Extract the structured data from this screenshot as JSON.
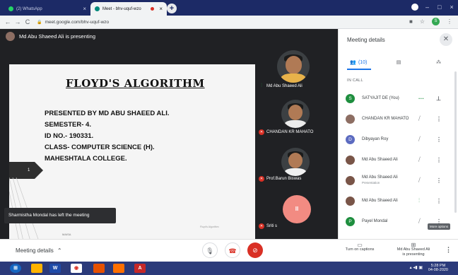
{
  "browser": {
    "tabs": [
      {
        "label": "(2) WhatsApp",
        "close": "×"
      },
      {
        "label": "Meet - bhv-uquf-wzo",
        "close": "×"
      }
    ],
    "new_tab": "+",
    "url": "meet.google.com/bhv-uquf-wzo"
  },
  "stage": {
    "presenting_text": "Md Abu Shaeed Ali is presenting"
  },
  "slide": {
    "title": "FLOYD'S ALGORITHM",
    "lines": [
      "PRESENTED BY MD ABU SHAEED ALI.",
      "SEMESTER- 4.",
      "ID NO.- 190331.",
      "CLASS- COMPUTER SCIENCE (H).",
      "MAHESHTALA COLLEGE."
    ],
    "page_number": "1",
    "footer_left": "MAISA",
    "footer_right": "Floyd's Algorithm"
  },
  "toast": "Sharmistha Mondal has left the meeting",
  "tiles": [
    {
      "name": "Md Abu Shaeed Ali"
    },
    {
      "name": "CHANDAN KR MAHATO"
    },
    {
      "name": "Prof.Barun Biswas"
    },
    {
      "name": "Sriti s",
      "initial": "II"
    }
  ],
  "panel": {
    "title": "Meeting details",
    "people_count": "(10)",
    "in_call_label": "IN CALL",
    "participants": [
      {
        "name": "SATYAJIT DE (You)",
        "initial": "S",
        "color": "#1e8e3e",
        "sub": ""
      },
      {
        "name": "CHANDAN KR MAHATO",
        "initial": "",
        "color": "#8d6e63",
        "sub": ""
      },
      {
        "name": "Dibyayan Roy",
        "initial": "D",
        "color": "#5c6bc0",
        "sub": ""
      },
      {
        "name": "Md Abu Shaeed Ali",
        "initial": "",
        "color": "#795548",
        "sub": ""
      },
      {
        "name": "Md Abu Shaeed Ali",
        "initial": "",
        "color": "#795548",
        "sub": "Presentation"
      },
      {
        "name": "Md Abu Shaeed Ali",
        "initial": "",
        "color": "#795548",
        "sub": ""
      },
      {
        "name": "Payel Mondal",
        "initial": "P",
        "color": "#1e8e3e",
        "sub": ""
      }
    ],
    "tooltip": "More options"
  },
  "bottom": {
    "meeting_details": "Meeting details",
    "captions": "Turn on captions",
    "presenting_line1": "Md Abu Shaeed Ali",
    "presenting_line2": "is presenting"
  },
  "taskbar": {
    "time": "5:28 PM",
    "date": "04-08-2020"
  }
}
